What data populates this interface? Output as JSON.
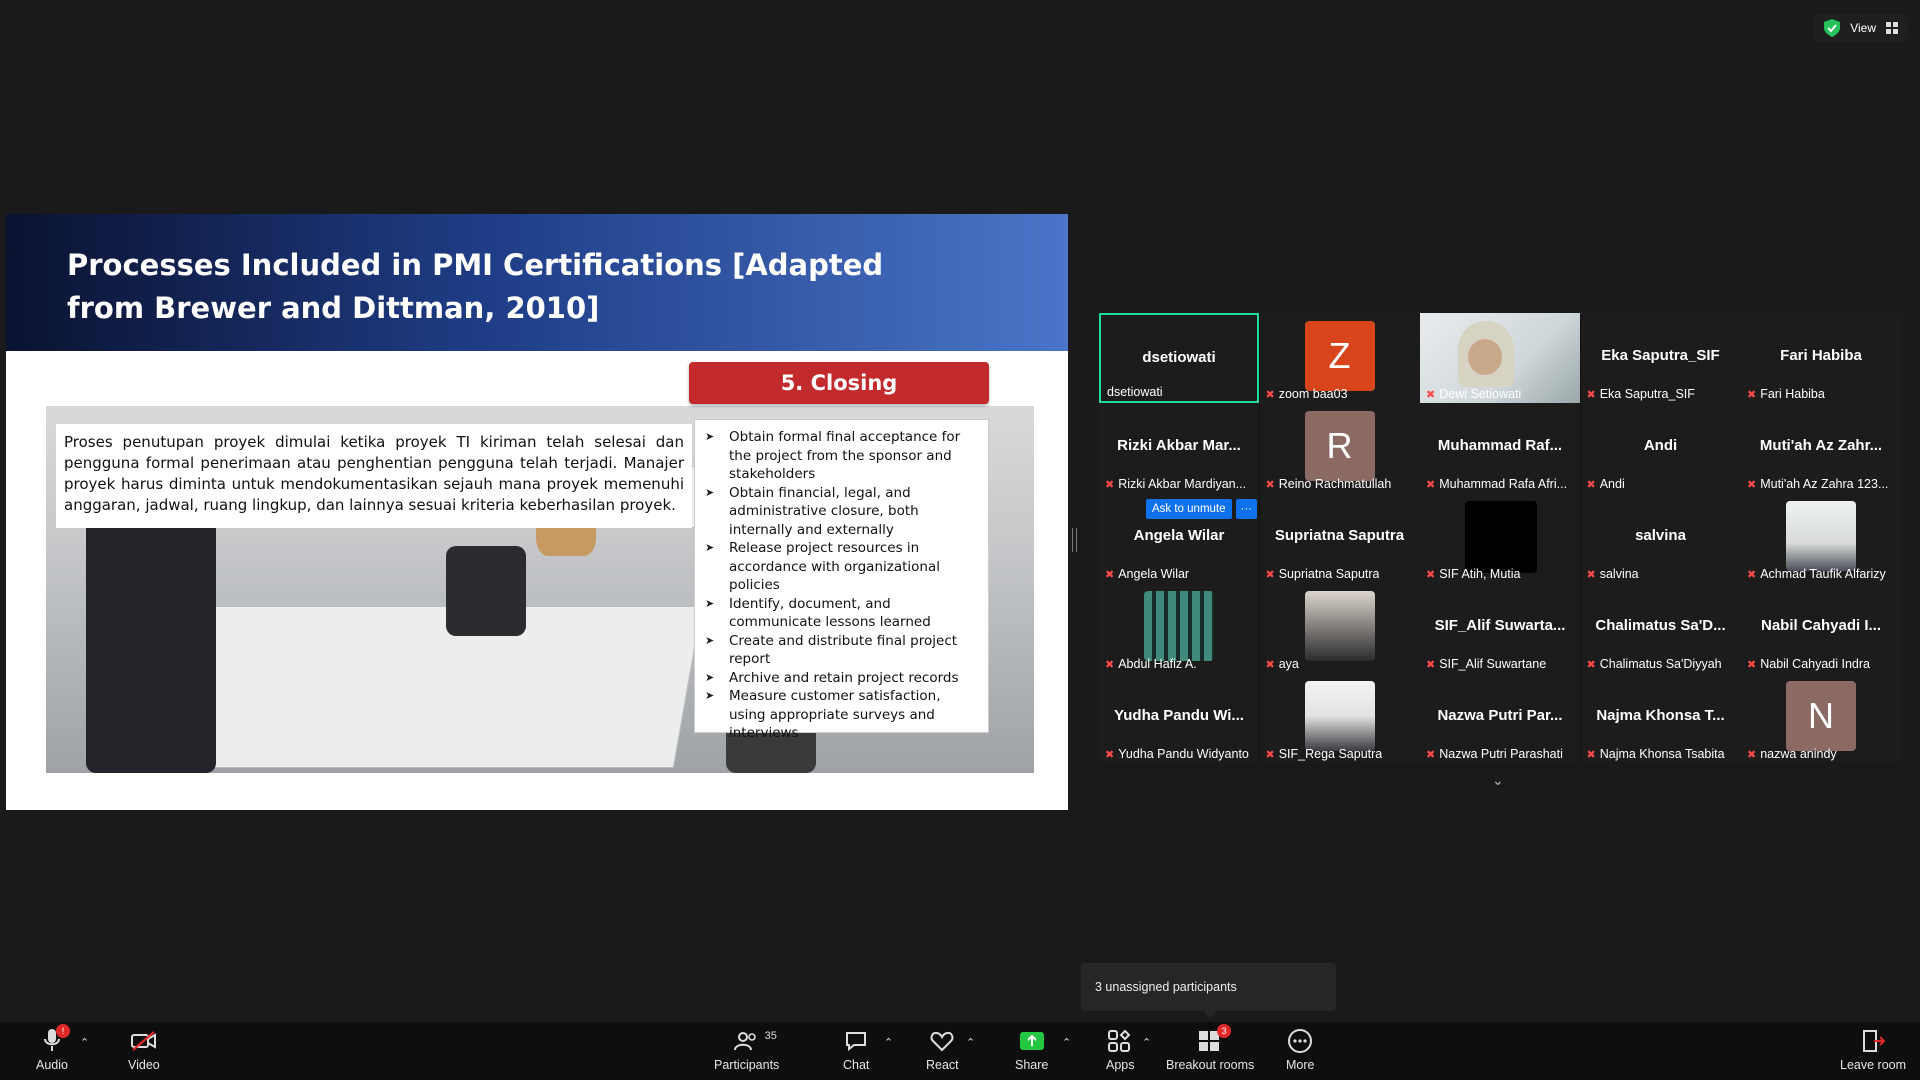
{
  "top_right": {
    "view_label": "View"
  },
  "slide": {
    "title": "Processes Included in PMI Certifications [Adapted from Brewer and Dittman, 2010]",
    "paragraph": "Proses penutupan proyek dimulai ketika proyek TI kiriman telah selesai dan pengguna formal penerimaan atau penghentian pengguna telah terjadi. Manajer proyek harus diminta untuk mendokumentasikan sejauh mana proyek memenuhi anggaran, jadwal, ruang lingkup, dan lainnya sesuai kriteria keberhasilan proyek.",
    "badge": "5. Closing",
    "bullets": [
      "Obtain formal final acceptance for the project from the sponsor and stakeholders",
      "Obtain financial, legal, and administrative closure, both internally and externally",
      "Release project resources in accordance with organizational policies",
      "Identify, document, and communicate lessons learned",
      "Create and distribute final project report",
      "Archive and retain project records",
      "Measure customer satisfaction, using appropriate surveys and interviews"
    ]
  },
  "gallery": {
    "tiles": [
      {
        "title": "dsetiowati",
        "label": "dsetiowati",
        "active": true,
        "muted": false
      },
      {
        "title": "",
        "label": "zoom baa03",
        "avatar": "Z",
        "avatar_color": "#d8441c",
        "muted": true
      },
      {
        "title": "",
        "label": "Dewi Setiowati",
        "video": true,
        "muted": true
      },
      {
        "title": "Eka Saputra_SIF",
        "label": "Eka Saputra_SIF",
        "muted": true
      },
      {
        "title": "Fari Habiba",
        "label": "Fari Habiba",
        "muted": true
      },
      {
        "title": "Rizki Akbar Mar...",
        "label": "Rizki Akbar Mardiyan...",
        "muted": true
      },
      {
        "title": "",
        "label": "Reino Rachmatullah",
        "avatar": "R",
        "avatar_color": "#8a6a62",
        "muted": true
      },
      {
        "title": "Muhammad Raf...",
        "label": "Muhammad Rafa Afri...",
        "muted": true
      },
      {
        "title": "Andi",
        "label": "Andi",
        "muted": true
      },
      {
        "title": "Muti'ah Az Zahr...",
        "label": "Muti'ah Az Zahra 123...",
        "muted": true
      },
      {
        "title": "Angela Wilar",
        "label": "Angela Wilar",
        "muted": true
      },
      {
        "title": "Supriatna Saputra",
        "label": "Supriatna Saputra",
        "muted": true
      },
      {
        "title": "",
        "label": "SIF Atih, Mutia",
        "black": true,
        "muted": true
      },
      {
        "title": "salvina",
        "label": "salvina",
        "muted": true
      },
      {
        "title": "",
        "label": "Achmad Taufik Alfarizy",
        "photo": true,
        "muted": true
      },
      {
        "title": "",
        "label": "Abdul Hafiz A.",
        "photo2": true,
        "muted": true
      },
      {
        "title": "",
        "label": "aya",
        "photo3": true,
        "muted": true
      },
      {
        "title": "SIF_Alif Suwarta...",
        "label": "SIF_Alif Suwartane",
        "muted": true
      },
      {
        "title": "Chalimatus Sa'D...",
        "label": "Chalimatus Sa'Diyyah",
        "muted": true
      },
      {
        "title": "Nabil Cahyadi I...",
        "label": "Nabil Cahyadi Indra",
        "muted": true
      },
      {
        "title": "Yudha Pandu Wi...",
        "label": "Yudha Pandu Widyanto",
        "muted": true
      },
      {
        "title": "",
        "label": "SIF_Rega Saputra",
        "photo4": true,
        "muted": true
      },
      {
        "title": "Nazwa Putri Par...",
        "label": "Nazwa Putri Parashati",
        "muted": true
      },
      {
        "title": "Najma Khonsa T...",
        "label": "Najma Khonsa Tsabita",
        "muted": true
      },
      {
        "title": "",
        "label": "nazwa anindy",
        "avatar": "N",
        "avatar_color": "#8a6a62",
        "muted": true
      }
    ],
    "ask_to_unmute": "Ask to unmute",
    "more_dots": "···"
  },
  "tooltip": "3 unassigned participants",
  "toolbar": {
    "audio": "Audio",
    "video": "Video",
    "participants": "Participants",
    "participants_count": "35",
    "chat": "Chat",
    "react": "React",
    "share": "Share",
    "apps": "Apps",
    "breakout": "Breakout rooms",
    "breakout_badge": "3",
    "more": "More",
    "leave": "Leave room",
    "audio_badge": "!"
  },
  "colors": {
    "accent_green": "#23d9a0",
    "zoom_blue": "#0e72ed",
    "badge_red": "#e02828",
    "share_green": "#24c73f"
  }
}
